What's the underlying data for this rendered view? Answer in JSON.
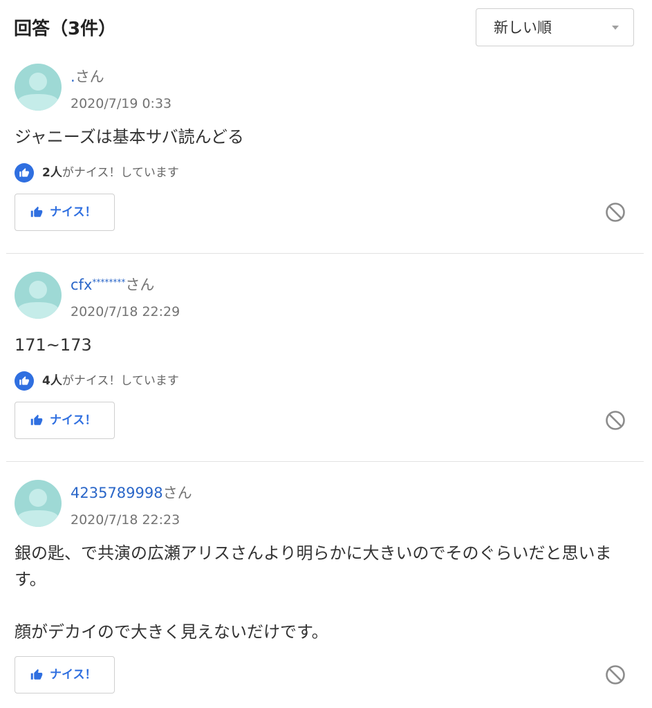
{
  "header": {
    "title": "回答（3件）",
    "sort": {
      "selected": "新しい順",
      "caret_icon": "caret-down-icon"
    }
  },
  "labels": {
    "nice_button": "ナイス！"
  },
  "icons": {
    "avatar": "default-user-avatar",
    "nice_badge": "thumbs-up-badge-icon",
    "nice_button": "thumbs-up-icon",
    "block": "block-icon"
  },
  "colors": {
    "text": "#333333",
    "muted": "#737373",
    "link": "#2a66c8",
    "accent": "#2f6fe0",
    "avatar_bg": "#9ed9d5",
    "avatar_fg": "#c5ece9",
    "border": "#cfcfcf",
    "divider": "#e2e2e2",
    "icon_gray": "#8c8c8c"
  },
  "answers": [
    {
      "user": {
        "id": ".",
        "suffix": "さん"
      },
      "date": "2020/7/19 0:33",
      "body": "ジャニーズは基本サバ読んどる",
      "nice": {
        "count": "2人",
        "text": "がナイス！しています"
      }
    },
    {
      "user": {
        "id": "cfx",
        "mask": "********",
        "suffix": "さん"
      },
      "date": "2020/7/18 22:29",
      "body": "171~173",
      "nice": {
        "count": "4人",
        "text": "がナイス！しています"
      }
    },
    {
      "user": {
        "id": "4235789998",
        "suffix": "さん"
      },
      "date": "2020/7/18 22:23",
      "body": "銀の匙、で共演の広瀬アリスさんより明らかに大きいのでそのぐらいだと思います。\n\n顔がデカイので大きく見えないだけです。"
    }
  ]
}
